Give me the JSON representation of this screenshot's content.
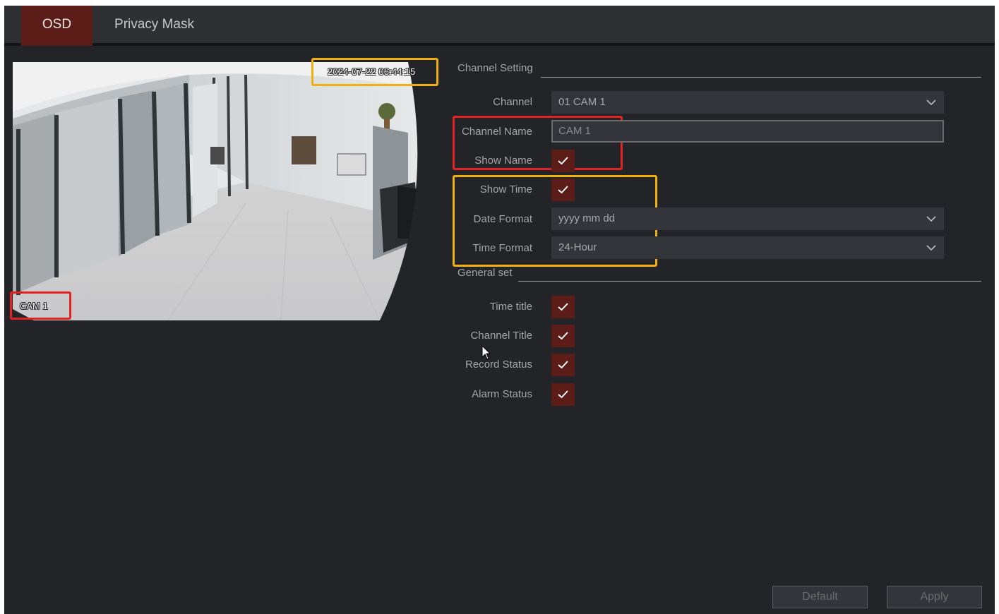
{
  "tabs": [
    {
      "label": "OSD",
      "active": true
    },
    {
      "label": "Privacy Mask",
      "active": false
    }
  ],
  "preview": {
    "timestamp": "2024-07-22 06:44:15",
    "channel_name_overlay": "CAM 1"
  },
  "channel_setting": {
    "title": "Channel Setting",
    "channel": {
      "label": "Channel",
      "value": "01 CAM 1"
    },
    "channel_name": {
      "label": "Channel Name",
      "value": "CAM 1"
    },
    "show_name": {
      "label": "Show Name",
      "checked": true
    },
    "show_time": {
      "label": "Show Time",
      "checked": true
    },
    "date_format": {
      "label": "Date Format",
      "value": "yyyy mm dd"
    },
    "time_format": {
      "label": "Time Format",
      "value": "24-Hour"
    }
  },
  "general_set": {
    "title": "General set",
    "time_title": {
      "label": "Time title",
      "checked": true
    },
    "channel_title": {
      "label": "Channel Title",
      "checked": true
    },
    "record_status": {
      "label": "Record Status",
      "checked": true
    },
    "alarm_status": {
      "label": "Alarm Status",
      "checked": true
    }
  },
  "buttons": {
    "default": "Default",
    "apply": "Apply"
  },
  "colors": {
    "accent": "#5c1c18",
    "highlight_yellow": "#f0b010",
    "highlight_red": "#e42222",
    "background": "#232428"
  }
}
